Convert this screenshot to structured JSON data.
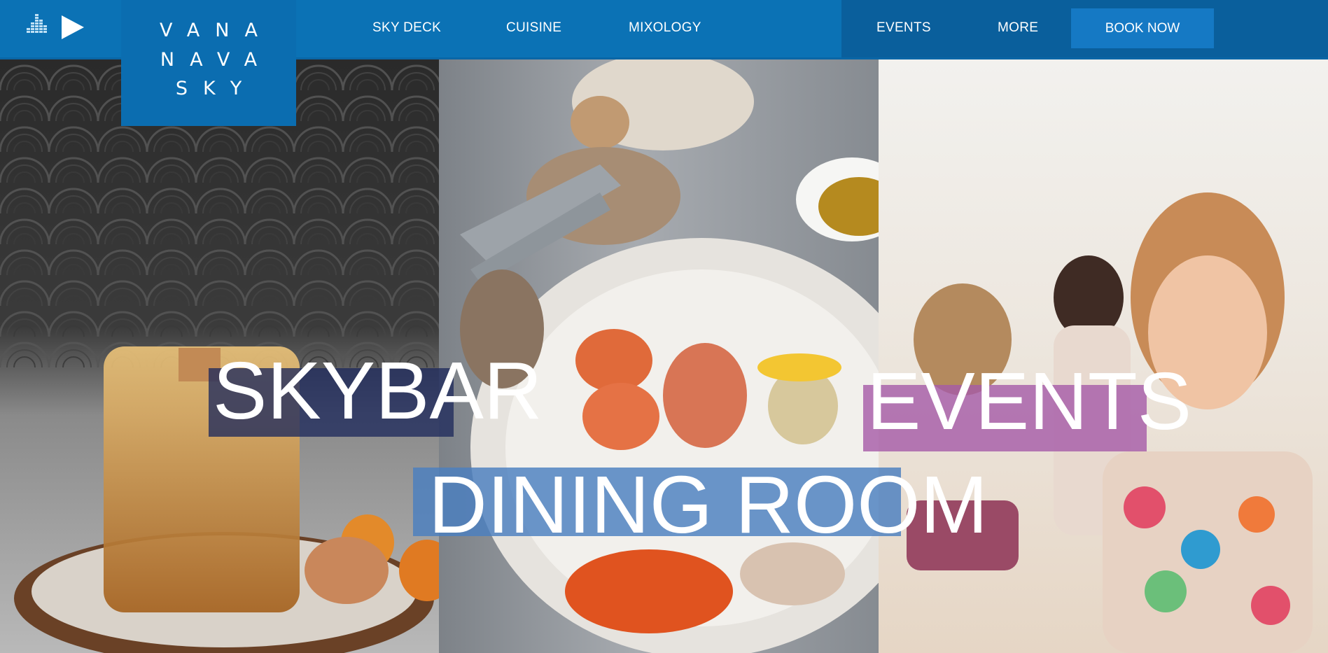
{
  "brand": {
    "lines": [
      "VANA",
      "NAVA",
      "SKY"
    ]
  },
  "nav": {
    "left": [
      "SKY DECK",
      "CUISINE",
      "MIXOLOGY"
    ],
    "right": [
      "EVENTS",
      "MORE"
    ],
    "cta": "BOOK NOW"
  },
  "controls": {
    "equalizer_icon": "equalizer-icon",
    "play_icon": "play-icon"
  },
  "hero": {
    "panels": [
      {
        "label": "SKYBAR",
        "highlight": "#1f2a5c"
      },
      {
        "label": "DINING ROOM",
        "highlight": "#4a7fc0"
      },
      {
        "label": "EVENTS",
        "highlight": "#a55aa8"
      }
    ]
  },
  "colors": {
    "topbar": "#0b72b5",
    "topbar_right": "#0a5f9c",
    "logo_bg": "#0b6db0",
    "cta_bg": "#1579c4"
  }
}
